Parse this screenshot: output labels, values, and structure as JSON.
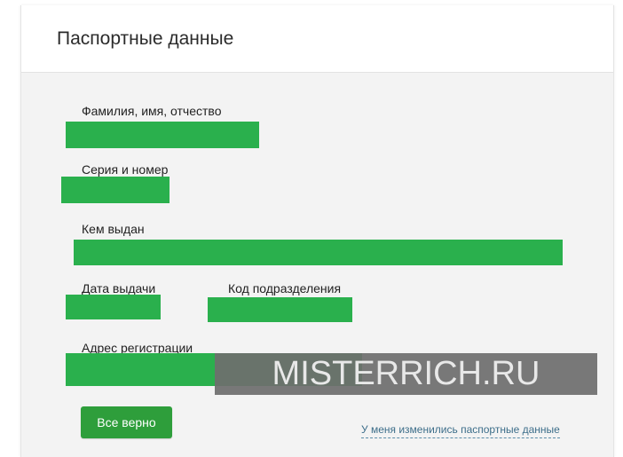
{
  "header": {
    "title": "Паспортные данные"
  },
  "fields": {
    "full_name_label": "Фамилия, имя, отчество",
    "series_number_label": "Серия и номер",
    "issued_by_label": "Кем выдан",
    "issue_date_label": "Дата выдачи",
    "subdivision_code_label": "Код подразделения",
    "registration_address_label": "Адрес регистрации"
  },
  "watermark": {
    "text": "MISTERRICH.RU"
  },
  "actions": {
    "confirm_label": "Все верно",
    "changed_link_label": "У меня изменились паспортные данные"
  },
  "colors": {
    "redaction": "#2ab04d",
    "button": "#2e9e3b",
    "link": "#3d6e8a",
    "panel_background": "#f3f3f3"
  }
}
